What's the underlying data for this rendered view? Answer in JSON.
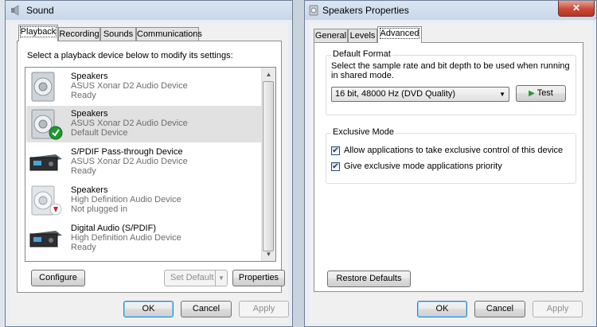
{
  "sound_dialog": {
    "title": "Sound",
    "tabs": [
      {
        "label": "Playback"
      },
      {
        "label": "Recording"
      },
      {
        "label": "Sounds"
      },
      {
        "label": "Communications"
      }
    ],
    "instruction": "Select a playback device below to modify its settings:",
    "devices": [
      {
        "name": "Speakers",
        "device": "ASUS Xonar D2 Audio Device",
        "status": "Ready",
        "icon": "speaker-icon"
      },
      {
        "name": "Speakers",
        "device": "ASUS Xonar D2 Audio Device",
        "status": "Default Device",
        "icon": "speaker-default-icon"
      },
      {
        "name": "S/PDIF Pass-through Device",
        "device": "ASUS Xonar D2 Audio Device",
        "status": "Ready",
        "icon": "digital-audio-icon"
      },
      {
        "name": "Speakers",
        "device": "High Definition Audio Device",
        "status": "Not plugged in",
        "icon": "speaker-unplugged-icon"
      },
      {
        "name": "Digital Audio (S/PDIF)",
        "device": "High Definition Audio Device",
        "status": "Ready",
        "icon": "digital-audio-icon"
      }
    ],
    "buttons": {
      "configure": "Configure",
      "set_default": "Set Default",
      "properties": "Properties",
      "ok": "OK",
      "cancel": "Cancel",
      "apply": "Apply"
    }
  },
  "speakers_properties": {
    "title": "Speakers Properties",
    "tabs": [
      {
        "label": "General"
      },
      {
        "label": "Levels"
      },
      {
        "label": "Advanced"
      }
    ],
    "default_format": {
      "group_title": "Default Format",
      "description_line1": "Select the sample rate and bit depth to be used when running",
      "description_line2": "in shared mode.",
      "selected_format": "16 bit, 48000 Hz (DVD Quality)",
      "test_label": "Test"
    },
    "exclusive_mode": {
      "group_title": "Exclusive Mode",
      "option1": "Allow applications to take exclusive control of this device",
      "option1_checked": true,
      "option2": "Give exclusive mode applications priority",
      "option2_checked": true
    },
    "buttons": {
      "restore_defaults": "Restore Defaults",
      "ok": "OK",
      "cancel": "Cancel",
      "apply": "Apply"
    }
  },
  "colors": {
    "accent_green": "#1f9a2e",
    "unplugged_red": "#c8232c",
    "selected_row": "#e1e1e1"
  }
}
